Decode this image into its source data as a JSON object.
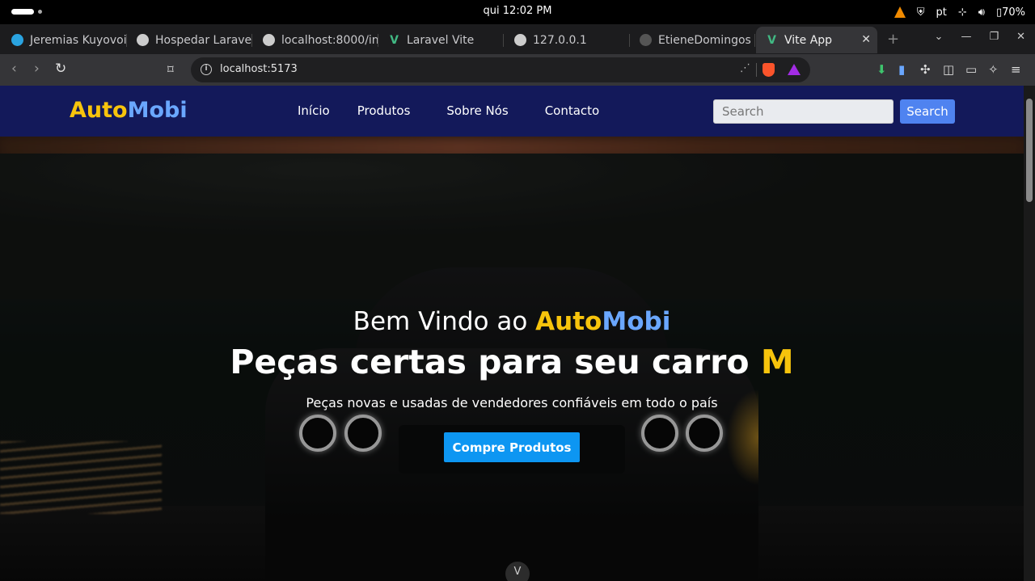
{
  "os": {
    "clock": "qui 12:02 PM",
    "language": "pt",
    "battery": "70%"
  },
  "browser": {
    "tabs": [
      {
        "title": "Jeremias Kuyovoi",
        "icon": "telegram-icon",
        "color": "#2aa3e0"
      },
      {
        "title": "Hospedar Laravel",
        "icon": "openai-icon",
        "color": "#cccccc"
      },
      {
        "title": "localhost:8000/in",
        "icon": "globe-icon",
        "color": "#cccccc"
      },
      {
        "title": "Laravel Vite",
        "icon": "vite-icon",
        "color": "#41b883"
      },
      {
        "title": "127.0.0.1",
        "icon": "globe-icon",
        "color": "#cccccc"
      },
      {
        "title": "EtieneDomingos",
        "icon": "github-icon",
        "color": "#555555"
      },
      {
        "title": "Vite App",
        "icon": "vite-icon",
        "color": "#41b883",
        "active": true
      }
    ],
    "address": "localhost:5173"
  },
  "site": {
    "brand_part1": "Auto",
    "brand_part2": "Mobi",
    "nav": [
      "Início",
      "Produtos",
      "Sobre Nós",
      "Contacto"
    ],
    "search_placeholder": "Search",
    "search_button": "Search"
  },
  "hero": {
    "welcome_prefix": "Bem Vindo ao ",
    "welcome_brand1": "Auto",
    "welcome_brand2": "Mobi",
    "title_main": "Peças certas para seu carro ",
    "title_accent": "M",
    "subtitle": "Peças novas e usadas de vendedores confiáveis em todo o país",
    "cta": "Compre Produtos"
  },
  "colors": {
    "brand_yellow": "#f7c40c",
    "brand_blue": "#6aa7ff",
    "navbar": "#13195a",
    "cta": "#0d96f2",
    "search_button": "#4f83f0"
  }
}
